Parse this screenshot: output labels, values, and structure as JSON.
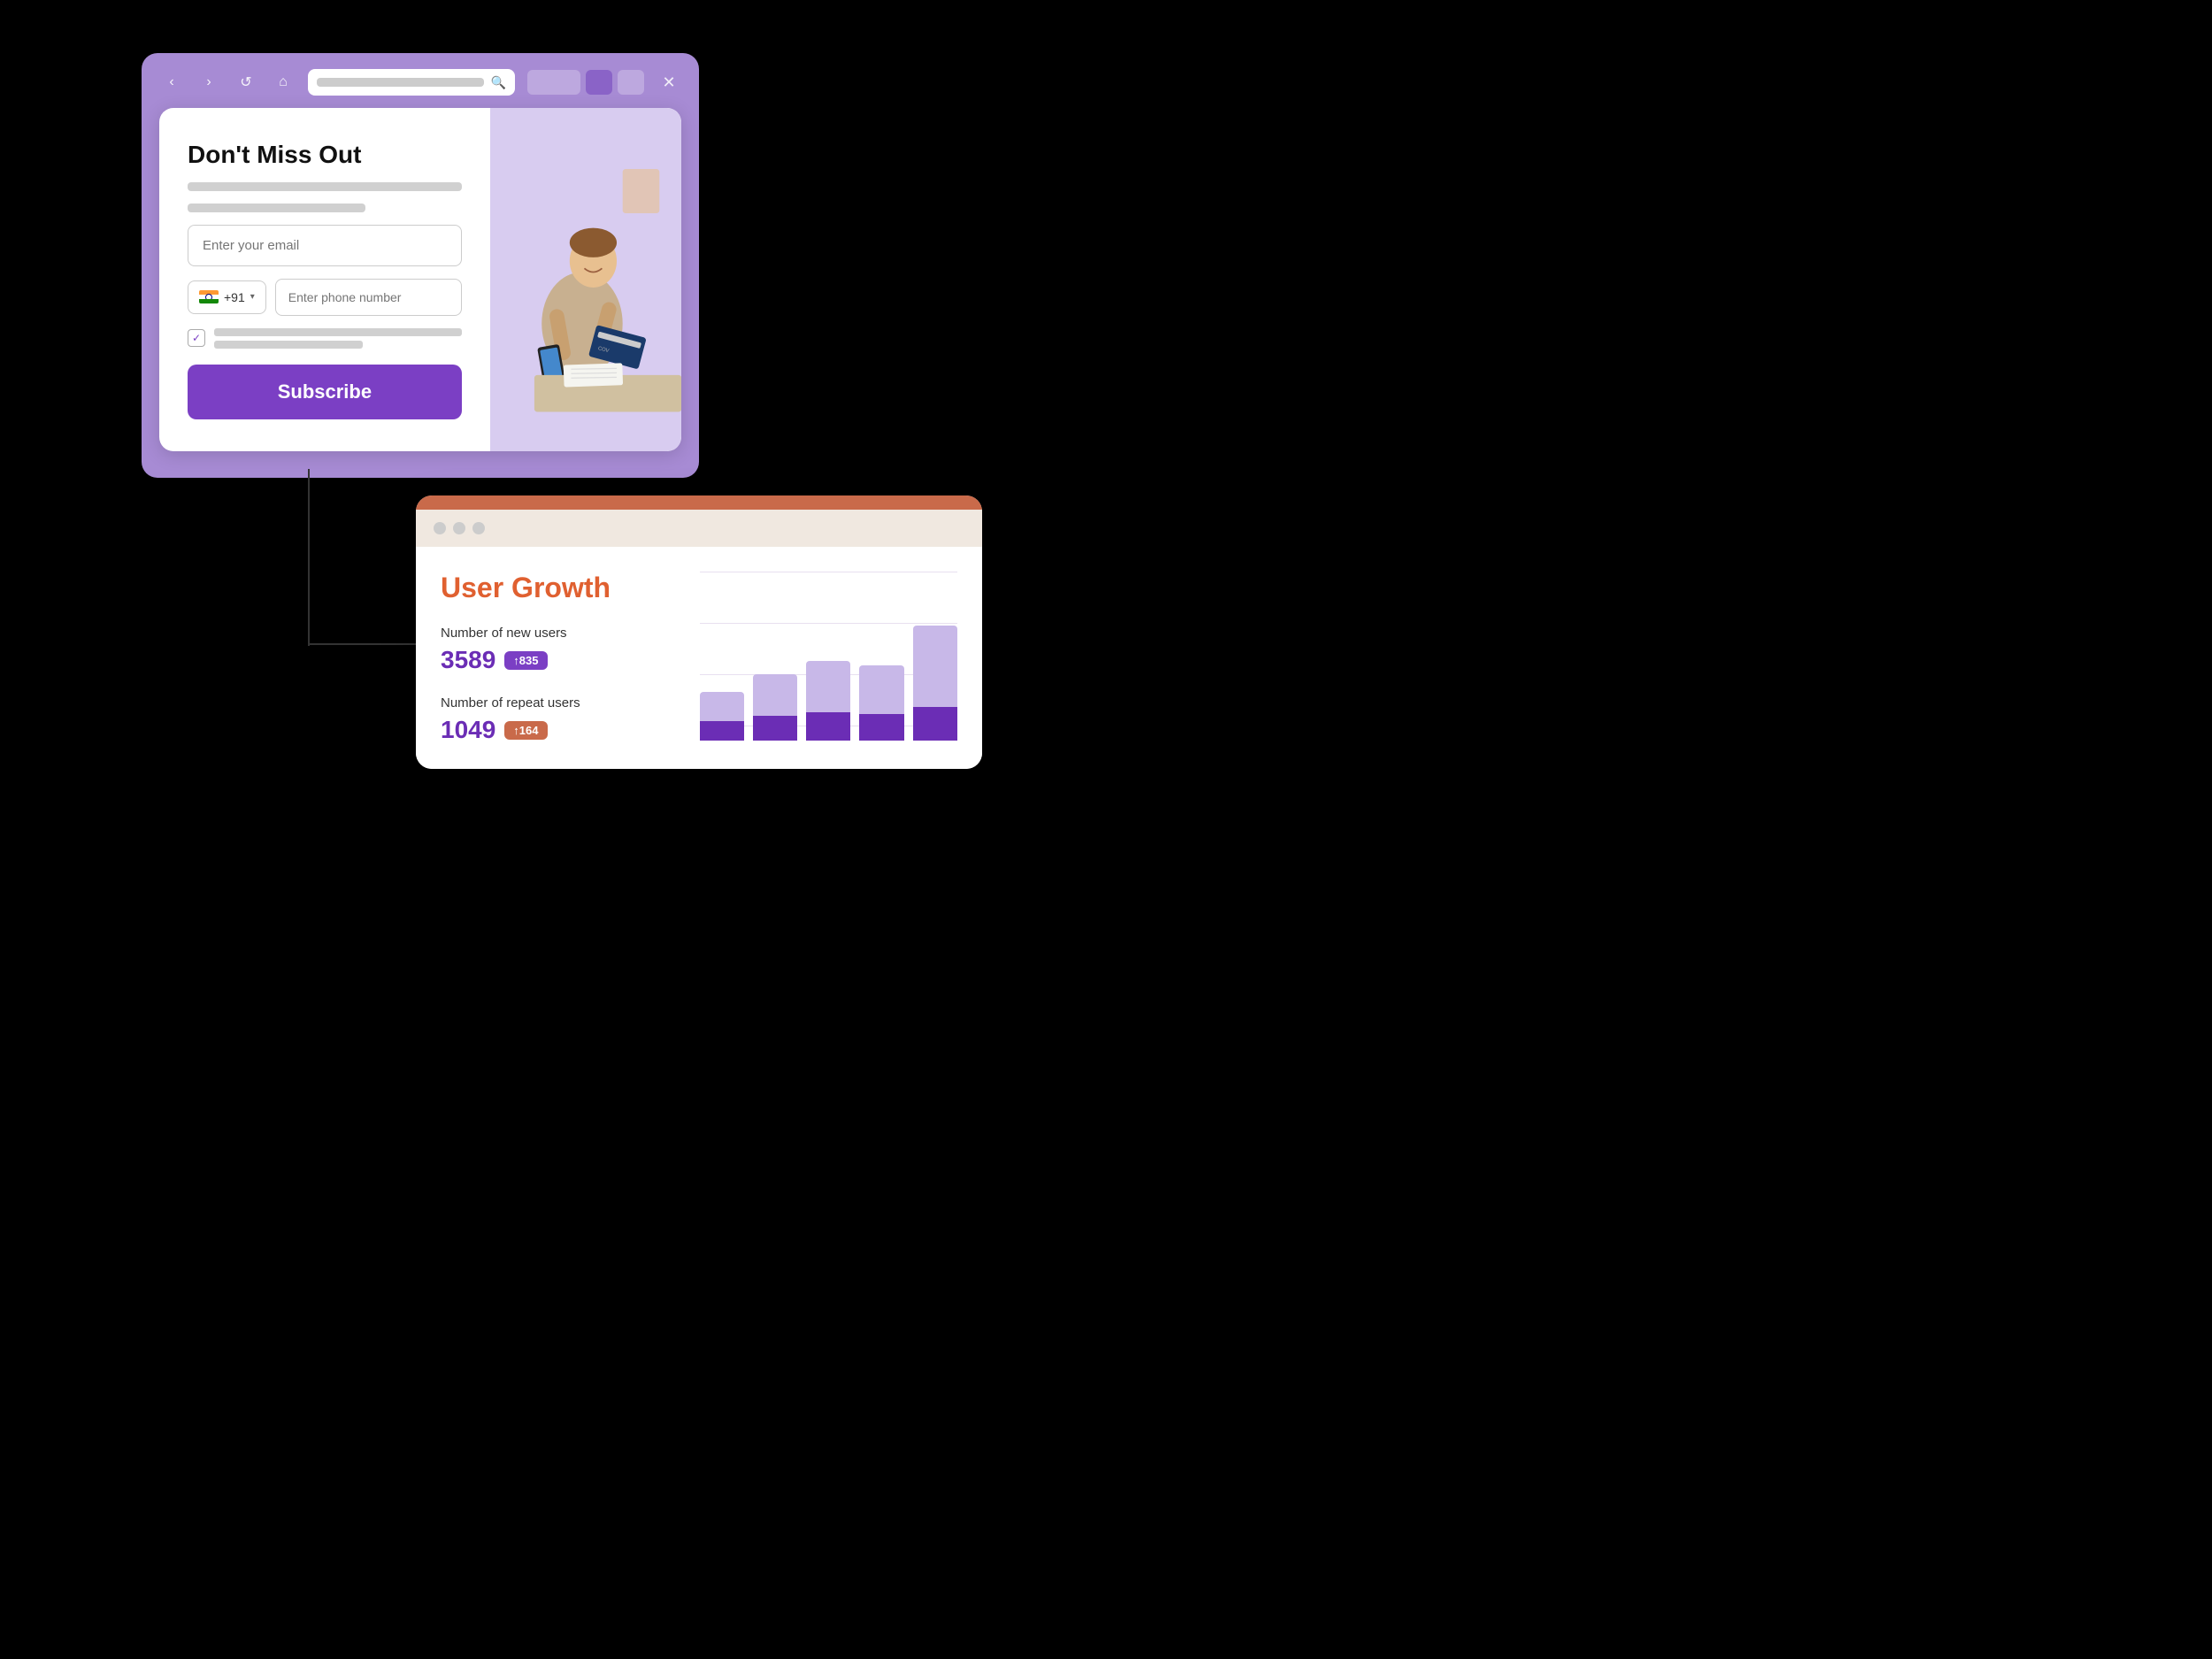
{
  "browser": {
    "nav": {
      "back": "‹",
      "forward": "›",
      "refresh": "↺",
      "home": "⌂",
      "close": "✕"
    }
  },
  "popup": {
    "title": "Don't Miss Out",
    "email_placeholder": "Enter your email",
    "country_code": "+91",
    "phone_placeholder": "Enter phone number",
    "checkbox_checked": "✓",
    "subscribe_label": "Subscribe"
  },
  "analytics": {
    "title": "User Growth",
    "new_users_label": "Number of new users",
    "new_users_value": "3589",
    "new_users_badge": "↑835",
    "repeat_users_label": "Number of repeat users",
    "repeat_users_value": "1049",
    "repeat_users_badge": "↑164",
    "chart": {
      "bars": [
        {
          "total": 55,
          "purple": 22
        },
        {
          "total": 75,
          "purple": 28
        },
        {
          "total": 90,
          "purple": 32
        },
        {
          "total": 85,
          "purple": 30
        },
        {
          "total": 130,
          "purple": 38
        }
      ]
    }
  }
}
